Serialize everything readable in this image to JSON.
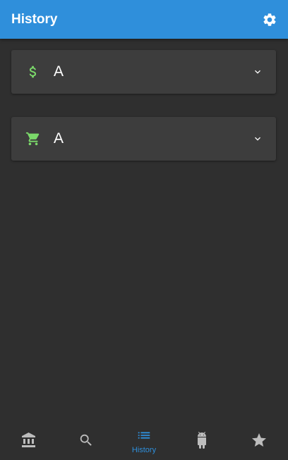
{
  "appbar": {
    "title": "History"
  },
  "cards": [
    {
      "icon": "dollar-icon",
      "label": "A"
    },
    {
      "icon": "cart-icon",
      "label": "A"
    }
  ],
  "bottom_nav": {
    "items": [
      {
        "icon": "bank-icon",
        "label": ""
      },
      {
        "icon": "search-icon",
        "label": ""
      },
      {
        "icon": "list-icon",
        "label": "History",
        "active": true
      },
      {
        "icon": "android-icon",
        "label": ""
      },
      {
        "icon": "star-icon",
        "label": ""
      }
    ]
  },
  "colors": {
    "accent": "#2f8fdb",
    "icon_green": "#7bd96a",
    "background": "#2f2f2f",
    "card": "#3d3d3d",
    "inactive_icon": "#bdbdbd"
  }
}
